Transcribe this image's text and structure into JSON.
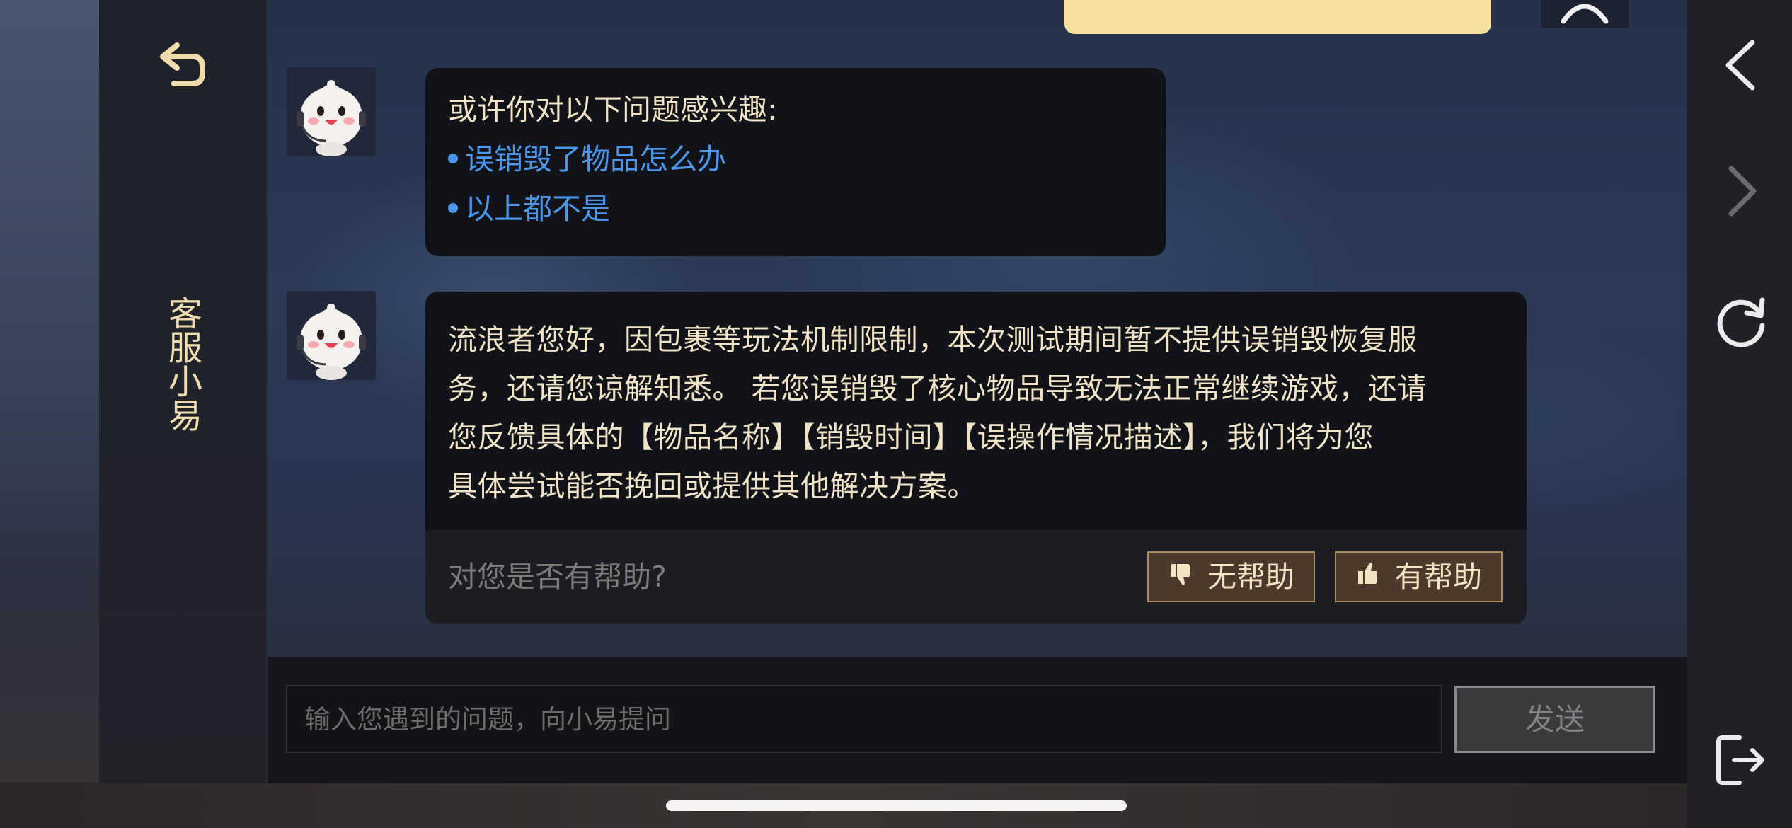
{
  "header": {
    "title": "客服小易"
  },
  "messages": {
    "suggestions_intro": "或许你对以下问题感兴趣:",
    "suggestions": [
      "误销毁了物品怎么办",
      "以上都不是"
    ],
    "answer": "流浪者您好，因包裹等玩法机制限制，本次测试期间暂不提供误销毁恢复服\n务，还请您谅解知悉。 若您误销毁了核心物品导致无法正常继续游戏，还请\n您反馈具体的【物品名称】【销毁时间】【误操作情况描述】，我们将为您\n具体尝试能否挽回或提供其他解决方案。",
    "feedback_question": "对您是否有帮助?",
    "not_helpful_label": "无帮助",
    "helpful_label": "有帮助"
  },
  "composer": {
    "placeholder": "输入您遇到的问题，向小易提问",
    "send_label": "发送"
  },
  "icons": {
    "back": "return-arrow-icon",
    "nav_back": "chevron-left-icon",
    "nav_forward": "chevron-right-icon",
    "refresh": "refresh-icon",
    "exit": "exit-icon",
    "thumbs_down": "thumbs-down-icon",
    "thumbs_up": "thumbs-up-icon"
  },
  "colors": {
    "accent_gold": "#efdcae",
    "link_blue": "#4b97ec",
    "bubble_bg": "#121318",
    "user_bubble": "#f7df9e",
    "button_bg": "#4b3a2c"
  }
}
